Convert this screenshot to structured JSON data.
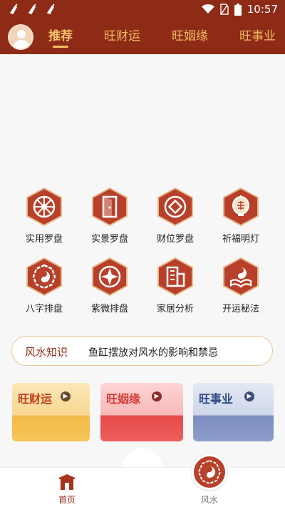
{
  "status_bar": {
    "time": "10:57",
    "left_icons": [
      "broom-icon",
      "broom-icon",
      "broom-icon"
    ],
    "right_icons": [
      "wifi-icon",
      "sim-icon",
      "battery-icon"
    ]
  },
  "top_nav": {
    "avatar_icon": "avatar-icon",
    "tabs": [
      {
        "label": "推荐",
        "active": true
      },
      {
        "label": "旺财运",
        "active": false
      },
      {
        "label": "旺姻缘",
        "active": false
      },
      {
        "label": "旺事业",
        "active": false
      }
    ]
  },
  "grid": {
    "items": [
      {
        "label": "实用罗盘",
        "icon": "compass-wheel-icon"
      },
      {
        "label": "实景罗盘",
        "icon": "door-icon"
      },
      {
        "label": "财位罗盘",
        "icon": "coin-icon"
      },
      {
        "label": "祈福明灯",
        "icon": "lantern-icon"
      },
      {
        "label": "八字排盘",
        "icon": "bagua-icon"
      },
      {
        "label": "紫微排盘",
        "icon": "star-compass-icon"
      },
      {
        "label": "家居分析",
        "icon": "building-icon"
      },
      {
        "label": "开运秘法",
        "icon": "open-book-icon"
      }
    ]
  },
  "knowledge": {
    "title": "风水知识",
    "content": "鱼缸摆放对风水的影响和禁忌"
  },
  "cards": {
    "wealth": "旺财运",
    "marriage": "旺姻缘",
    "career": "旺事业"
  },
  "bottom_nav": {
    "home_label": "首页",
    "fengshui_label": "风水"
  },
  "colors": {
    "brand": "#8e2b17",
    "accent": "#f5c067",
    "icon_hex": "#b8402a"
  }
}
